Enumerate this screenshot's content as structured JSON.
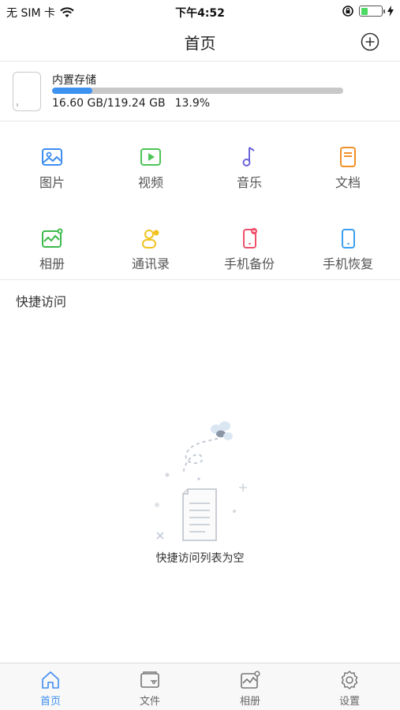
{
  "status_bar": {
    "carrier": "无 SIM 卡",
    "time": "下午4:52"
  },
  "nav": {
    "title": "首页"
  },
  "storage": {
    "title": "内置存储",
    "usage": "16.60 GB/119.24 GB",
    "percent": "13.9%",
    "used_fraction": 0.139
  },
  "grid": [
    {
      "label": "图片",
      "icon": "image-icon",
      "color": "#3d8ef0"
    },
    {
      "label": "视频",
      "icon": "video-icon",
      "color": "#4cc456"
    },
    {
      "label": "音乐",
      "icon": "music-icon",
      "color": "#6b63d8"
    },
    {
      "label": "文档",
      "icon": "document-icon",
      "color": "#f0902a"
    },
    {
      "label": "相册",
      "icon": "album-icon",
      "color": "#3cb94a"
    },
    {
      "label": "通讯录",
      "icon": "contacts-icon",
      "color": "#f2c21e"
    },
    {
      "label": "手机备份",
      "icon": "phone-backup-icon",
      "color": "#ef4f6a"
    },
    {
      "label": "手机恢复",
      "icon": "phone-restore-icon",
      "color": "#3d9fee"
    }
  ],
  "quick_access": {
    "title": "快捷访问",
    "empty_text": "快捷访问列表为空"
  },
  "tabs": [
    {
      "label": "首页",
      "icon": "home-icon",
      "active": true
    },
    {
      "label": "文件",
      "icon": "files-icon",
      "active": false
    },
    {
      "label": "相册",
      "icon": "album-icon",
      "active": false
    },
    {
      "label": "设置",
      "icon": "settings-icon",
      "active": false
    }
  ],
  "colors": {
    "accent": "#3d8ef0",
    "storage_track": "#c8c8c8"
  }
}
